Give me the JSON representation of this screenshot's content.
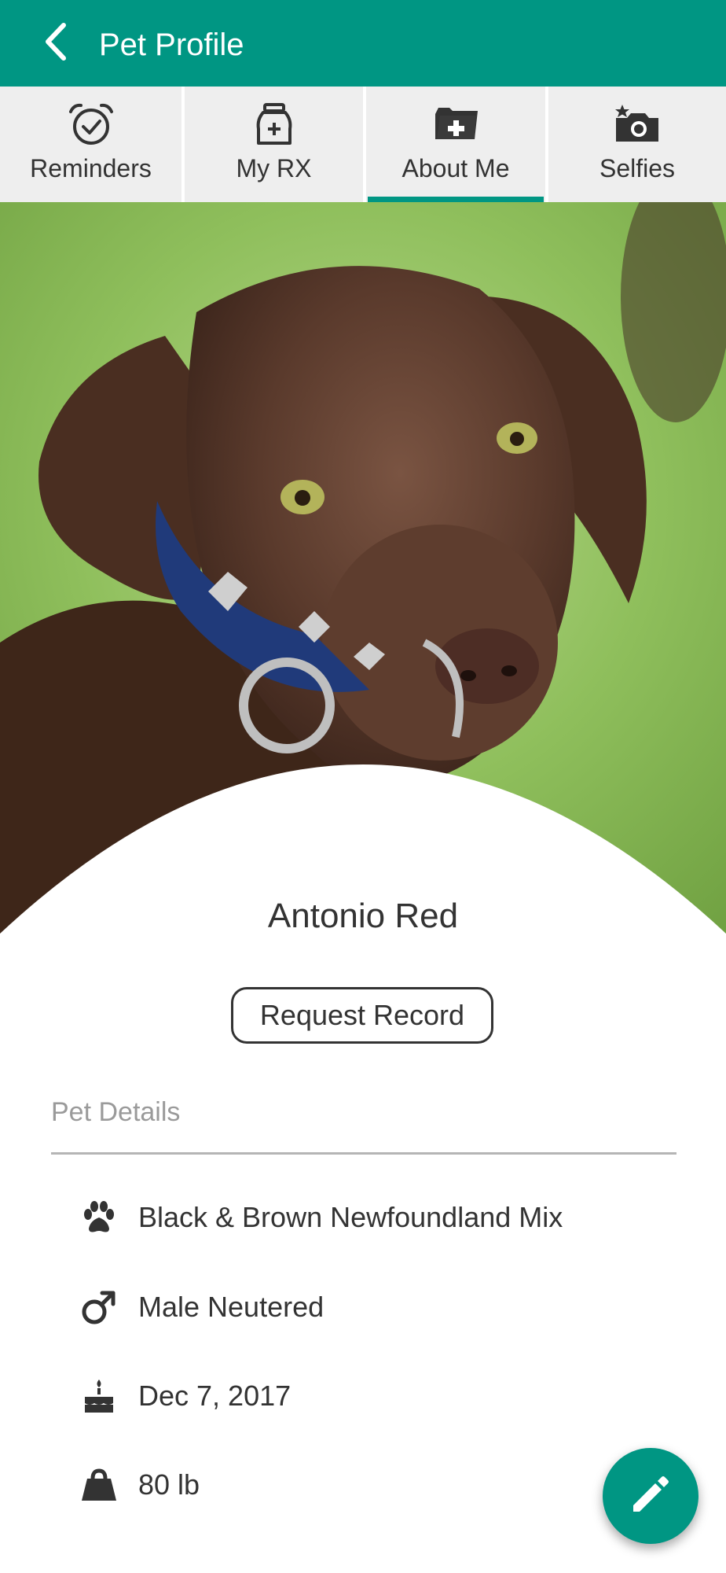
{
  "appbar": {
    "title": "Pet Profile",
    "color": "#009683"
  },
  "tabs": [
    {
      "label": "Reminders",
      "icon": "alarm-check-icon",
      "active": false
    },
    {
      "label": "My RX",
      "icon": "medicine-bag-icon",
      "active": false
    },
    {
      "label": "About Me",
      "icon": "medical-folder-icon",
      "active": true
    },
    {
      "label": "Selfies",
      "icon": "camera-star-icon",
      "active": false
    }
  ],
  "profile": {
    "name": "Antonio Red",
    "request_button": "Request Record"
  },
  "details": {
    "section_title": "Pet Details",
    "items": [
      {
        "icon": "paw-icon",
        "text": "Black & Brown Newfoundland Mix"
      },
      {
        "icon": "male-icon",
        "text": "Male Neutered"
      },
      {
        "icon": "birthday-cake-icon",
        "text": "Dec 7, 2017"
      },
      {
        "icon": "weight-icon",
        "text": "80 lb"
      }
    ]
  },
  "fab": {
    "icon": "edit-pencil-icon"
  }
}
